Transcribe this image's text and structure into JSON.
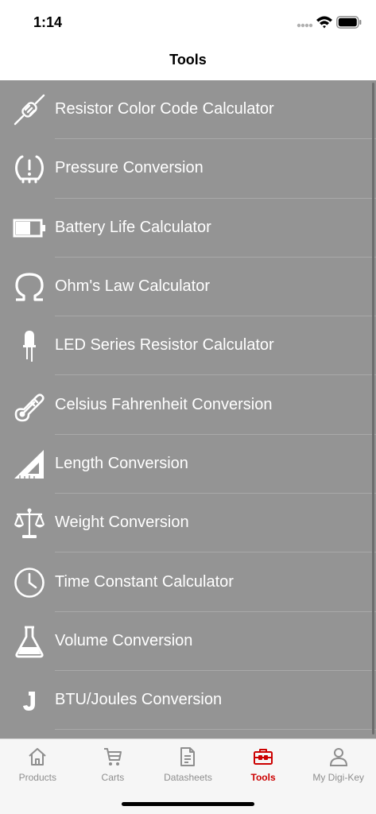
{
  "status_bar": {
    "time": "1:14"
  },
  "nav": {
    "title": "Tools"
  },
  "tools": [
    {
      "label": "Resistor Color Code Calculator",
      "icon": "resistor-icon"
    },
    {
      "label": "Pressure Conversion",
      "icon": "pressure-icon"
    },
    {
      "label": "Battery Life Calculator",
      "icon": "battery-life-icon"
    },
    {
      "label": "Ohm's Law Calculator",
      "icon": "ohm-icon"
    },
    {
      "label": "LED Series Resistor Calculator",
      "icon": "led-icon"
    },
    {
      "label": "Celsius Fahrenheit Conversion",
      "icon": "thermometer-icon"
    },
    {
      "label": "Length Conversion",
      "icon": "ruler-triangle-icon"
    },
    {
      "label": "Weight Conversion",
      "icon": "scale-icon"
    },
    {
      "label": "Time Constant Calculator",
      "icon": "clock-icon"
    },
    {
      "label": "Volume Conversion",
      "icon": "flask-icon"
    },
    {
      "label": "BTU/Joules Conversion",
      "icon": "joule-icon"
    }
  ],
  "tabs": [
    {
      "label": "Products",
      "icon": "home-icon",
      "active": false
    },
    {
      "label": "Carts",
      "icon": "cart-icon",
      "active": false
    },
    {
      "label": "Datasheets",
      "icon": "document-icon",
      "active": false
    },
    {
      "label": "Tools",
      "icon": "toolbox-icon",
      "active": true
    },
    {
      "label": "My Digi-Key",
      "icon": "person-icon",
      "active": false
    }
  ],
  "colors": {
    "list_bg": "#949494",
    "active_tab": "#cc0000",
    "inactive_tab": "#8e8e8e"
  }
}
